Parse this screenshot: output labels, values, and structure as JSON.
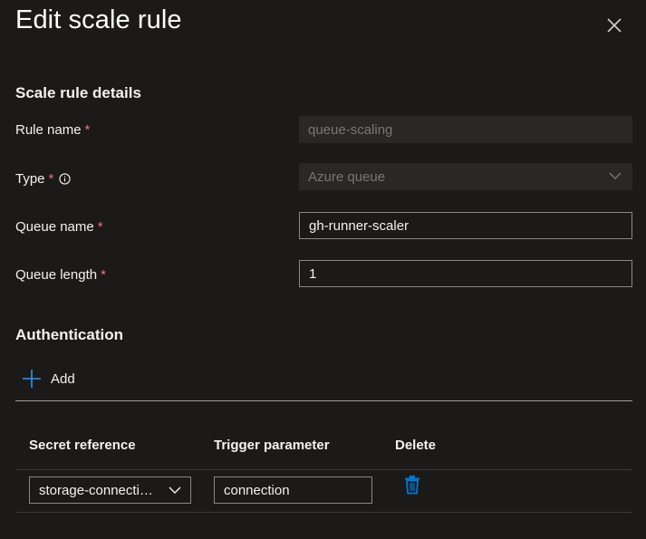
{
  "panel": {
    "title": "Edit scale rule"
  },
  "details": {
    "section_title": "Scale rule details",
    "rule_name_label": "Rule name",
    "rule_name_value": "queue-scaling",
    "type_label": "Type",
    "type_value": "Azure queue",
    "queue_name_label": "Queue name",
    "queue_name_value": "gh-runner-scaler",
    "queue_length_label": "Queue length",
    "queue_length_value": "1",
    "required_marker": "*"
  },
  "authentication": {
    "section_title": "Authentication",
    "add_label": "Add",
    "columns": [
      "Secret reference",
      "Trigger parameter",
      "Delete"
    ],
    "rows": [
      {
        "secret_reference": "storage-connection-string",
        "trigger_parameter": "connection"
      }
    ]
  },
  "icons": {
    "close": "close-icon",
    "info": "info-icon",
    "chevron": "chevron-down-icon",
    "add": "plus-icon",
    "delete": "trash-icon"
  },
  "colors": {
    "background": "#1b1a19",
    "required": "#f1707b",
    "accent": "#0078d4"
  }
}
